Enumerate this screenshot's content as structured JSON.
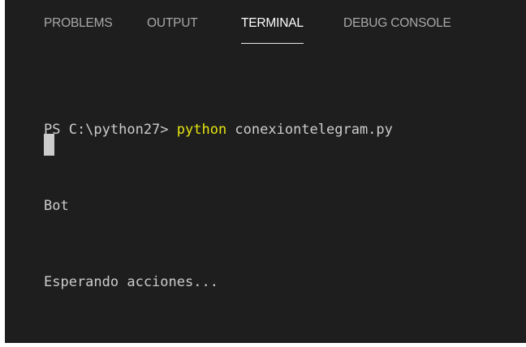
{
  "panel": {
    "tabs": [
      {
        "label": "PROBLEMS"
      },
      {
        "label": "OUTPUT"
      },
      {
        "label": "TERMINAL"
      },
      {
        "label": "DEBUG CONSOLE"
      }
    ],
    "active_tab": "TERMINAL"
  },
  "terminal": {
    "prompt": "PS C:\\python27> ",
    "command": "python",
    "args": " conexiontelegram.py",
    "output_lines": [
      "Bot",
      "Esperando acciones..."
    ]
  },
  "colors": {
    "background": "#1e1e1e",
    "text": "#cccccc",
    "command": "#e5e510",
    "active_tab": "#ffffff",
    "inactive_tab": "#a8a8a8"
  }
}
